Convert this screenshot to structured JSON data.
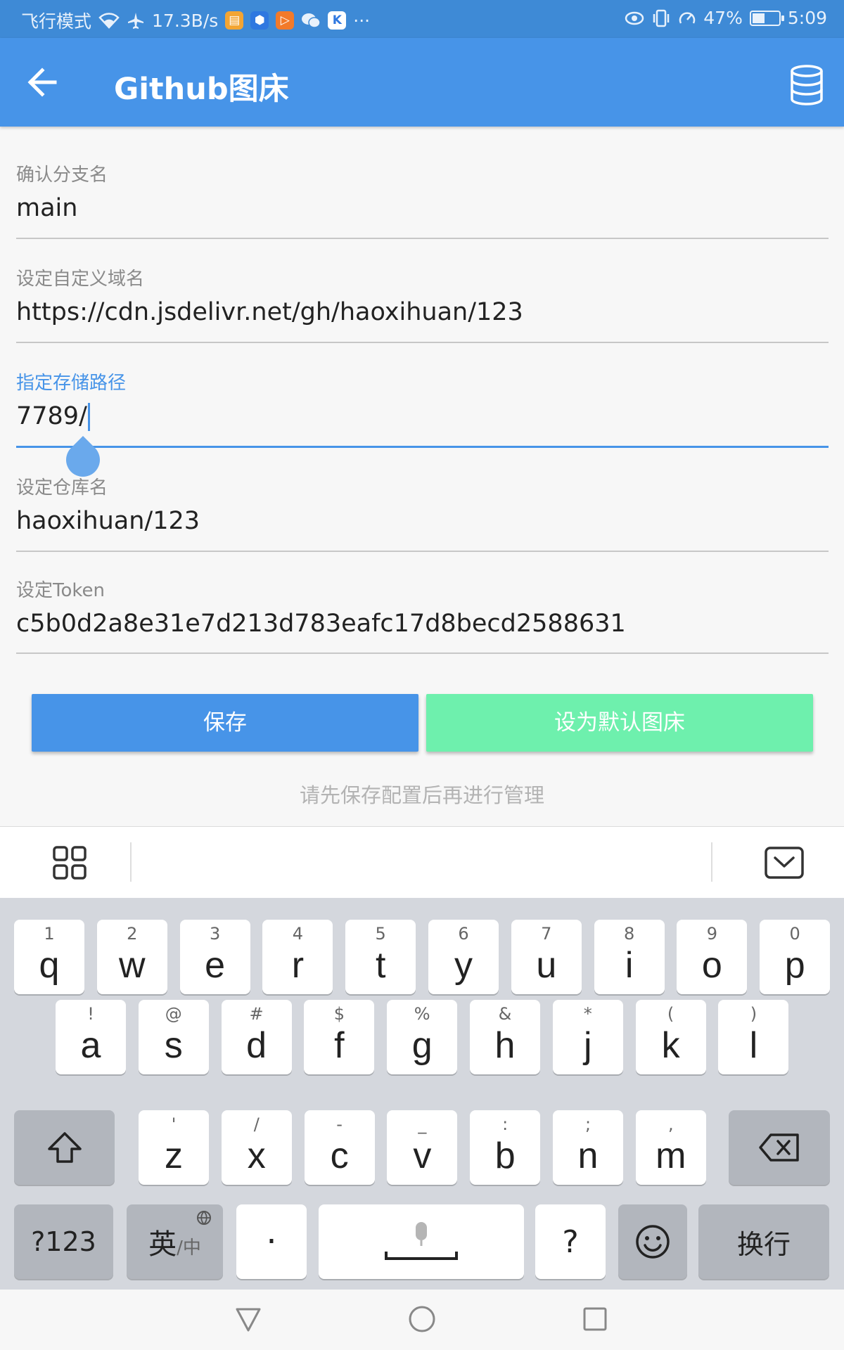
{
  "status_bar": {
    "airplane_mode": "飞行模式",
    "speed": "17.3B/s",
    "more": "···",
    "battery": "47%",
    "battery_level": 0.47,
    "time": "5:09"
  },
  "app_bar": {
    "title": "Github图床",
    "back_icon": "arrow-left-icon",
    "action_icon": "database-icon"
  },
  "form": {
    "branch": {
      "label": "确认分支名",
      "value": "main"
    },
    "domain": {
      "label": "设定自定义域名",
      "value": "https://cdn.jsdelivr.net/gh/haoxihuan/123"
    },
    "path": {
      "label": "指定存储路径",
      "value": "7789/"
    },
    "repo": {
      "label": "设定仓库名",
      "value": "haoxihuan/123"
    },
    "token": {
      "label": "设定Token",
      "value": "c5b0d2a8e31e7d213d783eafc17d8becd2588631"
    }
  },
  "actions": {
    "save": "保存",
    "set_default": "设为默认图床",
    "hint": "请先保存配置后再进行管理"
  },
  "keyboard": {
    "row1": [
      {
        "hint": "1",
        "char": "q"
      },
      {
        "hint": "2",
        "char": "w"
      },
      {
        "hint": "3",
        "char": "e"
      },
      {
        "hint": "4",
        "char": "r"
      },
      {
        "hint": "5",
        "char": "t"
      },
      {
        "hint": "6",
        "char": "y"
      },
      {
        "hint": "7",
        "char": "u"
      },
      {
        "hint": "8",
        "char": "i"
      },
      {
        "hint": "9",
        "char": "o"
      },
      {
        "hint": "0",
        "char": "p"
      }
    ],
    "row2": [
      {
        "hint": "!",
        "char": "a"
      },
      {
        "hint": "@",
        "char": "s"
      },
      {
        "hint": "#",
        "char": "d"
      },
      {
        "hint": "$",
        "char": "f"
      },
      {
        "hint": "%",
        "char": "g"
      },
      {
        "hint": "&",
        "char": "h"
      },
      {
        "hint": "*",
        "char": "j"
      },
      {
        "hint": "(",
        "char": "k"
      },
      {
        "hint": ")",
        "char": "l"
      }
    ],
    "row3": [
      {
        "hint": "'",
        "char": "z"
      },
      {
        "hint": "/",
        "char": "x"
      },
      {
        "hint": "-",
        "char": "c"
      },
      {
        "hint": "_",
        "char": "v"
      },
      {
        "hint": ":",
        "char": "b"
      },
      {
        "hint": ";",
        "char": "n"
      },
      {
        "hint": ",",
        "char": "m"
      }
    ],
    "symbols_key": "?123",
    "lang_key_main": "英",
    "lang_key_sub": "/中",
    "period_key": "·",
    "question_key": "?",
    "enter_key": "换行"
  }
}
